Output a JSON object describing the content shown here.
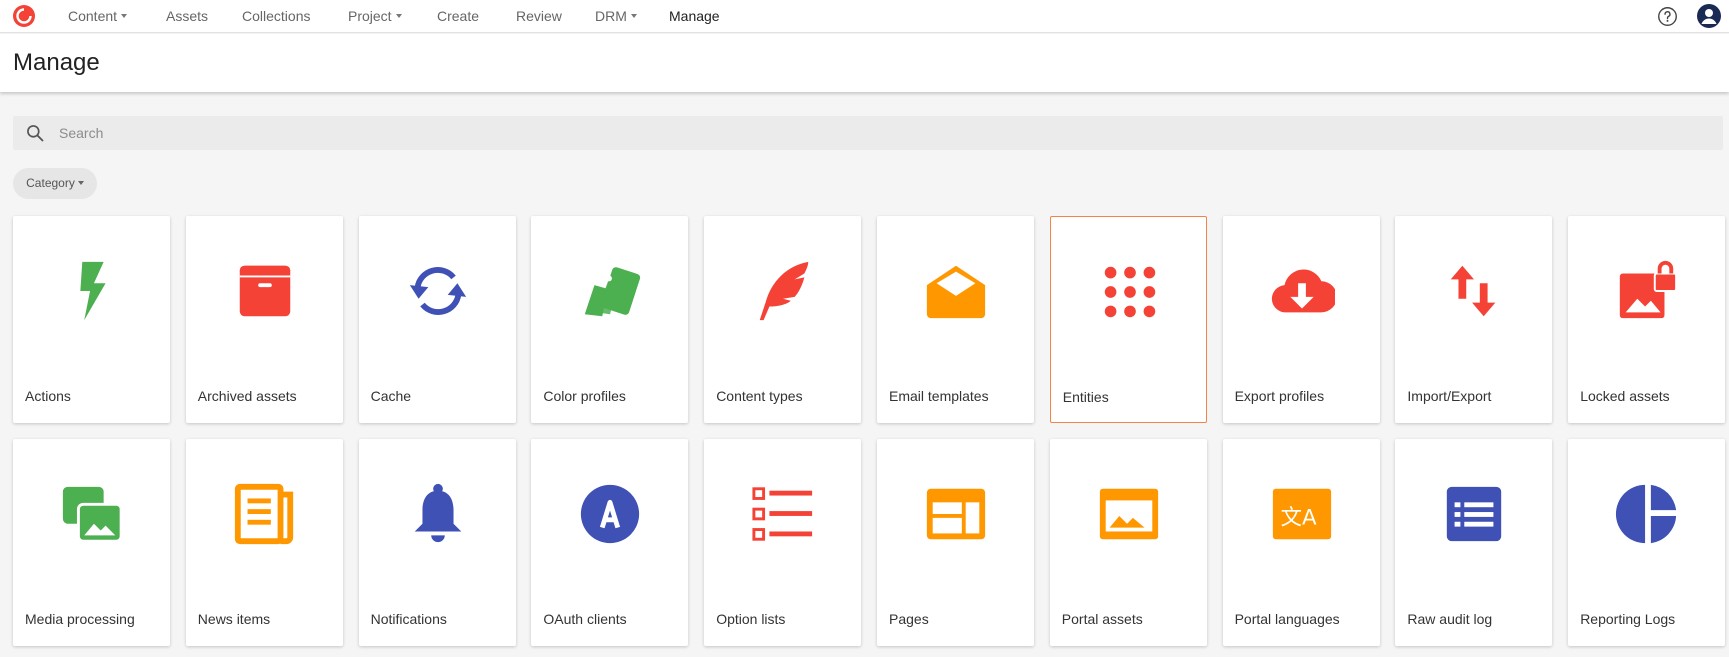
{
  "nav": {
    "items": [
      {
        "label": "Content",
        "dropdown": true
      },
      {
        "label": "Assets",
        "dropdown": false
      },
      {
        "label": "Collections",
        "dropdown": false
      },
      {
        "label": "Project",
        "dropdown": true
      },
      {
        "label": "Create",
        "dropdown": false
      },
      {
        "label": "Review",
        "dropdown": false
      },
      {
        "label": "DRM",
        "dropdown": true
      },
      {
        "label": "Manage",
        "dropdown": false,
        "active": true
      }
    ],
    "icons": {
      "logo": "brand-logo-icon",
      "help": "help-icon",
      "user": "user-avatar-icon"
    }
  },
  "page": {
    "title": "Manage"
  },
  "search": {
    "placeholder": "Search",
    "value": ""
  },
  "filter": {
    "category_label": "Category"
  },
  "colors": {
    "red": "#f44336",
    "green": "#4caf50",
    "blue": "#3f51b5",
    "orange": "#ff9800",
    "selected_border": "#f0844c"
  },
  "tiles": [
    {
      "label": "Actions",
      "icon": "lightning-bolt-icon",
      "color": "#4caf50"
    },
    {
      "label": "Archived assets",
      "icon": "archive-box-icon",
      "color": "#f44336"
    },
    {
      "label": "Cache",
      "icon": "sync-arrows-icon",
      "color": "#3f51b5"
    },
    {
      "label": "Color profiles",
      "icon": "color-cards-icon",
      "color": "#4caf50"
    },
    {
      "label": "Content types",
      "icon": "feather-icon",
      "color": "#f44336"
    },
    {
      "label": "Email templates",
      "icon": "open-envelope-icon",
      "color": "#ff9800"
    },
    {
      "label": "Entities",
      "icon": "dot-grid-icon",
      "color": "#f44336",
      "selected": true
    },
    {
      "label": "Export profiles",
      "icon": "cloud-download-icon",
      "color": "#f44336"
    },
    {
      "label": "Import/Export",
      "icon": "up-down-arrows-icon",
      "color": "#f44336"
    },
    {
      "label": "Locked assets",
      "icon": "locked-image-icon",
      "color": "#f44336"
    },
    {
      "label": "Media processing",
      "icon": "media-images-icon",
      "color": "#4caf50"
    },
    {
      "label": "News items",
      "icon": "newspaper-icon",
      "color": "#ff9800"
    },
    {
      "label": "Notifications",
      "icon": "bell-icon",
      "color": "#3f51b5"
    },
    {
      "label": "OAuth clients",
      "icon": "oauth-badge-icon",
      "color": "#3f51b5"
    },
    {
      "label": "Option lists",
      "icon": "checklist-icon",
      "color": "#f44336"
    },
    {
      "label": "Pages",
      "icon": "page-layout-icon",
      "color": "#ff9800"
    },
    {
      "label": "Portal assets",
      "icon": "portal-image-icon",
      "color": "#ff9800"
    },
    {
      "label": "Portal languages",
      "icon": "translate-icon",
      "color": "#ff9800"
    },
    {
      "label": "Raw audit log",
      "icon": "log-list-icon",
      "color": "#3f51b5"
    },
    {
      "label": "Reporting Logs",
      "icon": "pie-chart-icon",
      "color": "#3f51b5"
    }
  ]
}
